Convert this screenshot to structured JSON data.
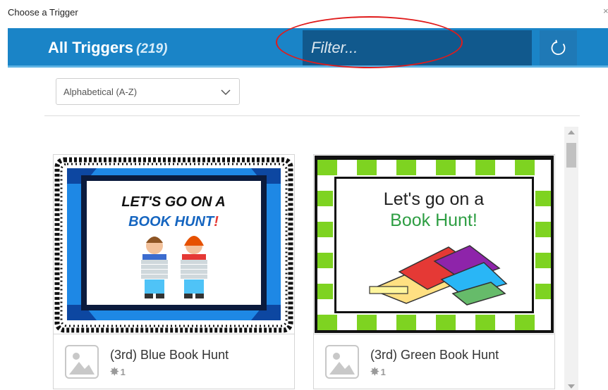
{
  "window": {
    "title": "Choose a Trigger",
    "close": "×"
  },
  "header": {
    "title": "All Triggers",
    "count": "(219)"
  },
  "filter": {
    "placeholder": "Filter..."
  },
  "sort": {
    "selected": "Alphabetical (A-Z)"
  },
  "triggers": [
    {
      "name": "(3rd) Blue Book Hunt",
      "count": "1",
      "image": {
        "line1": "LET'S GO ON A",
        "line2": "BOOK HUNT",
        "line2_suffix": "!"
      }
    },
    {
      "name": "(3rd) Green Book Hunt",
      "count": "1",
      "image": {
        "line1": "Let's go on a",
        "line2": "Book Hunt",
        "line2_suffix": "!"
      }
    }
  ],
  "colors": {
    "header": "#1a84c7",
    "filter_bg": "#11598d",
    "annotation": "#e01b1b",
    "blue_frame": "#1e88e5",
    "green_frame": "#7ed321"
  },
  "icons": [
    "close-icon",
    "refresh-icon",
    "chevron-down-icon",
    "image-placeholder-icon",
    "star-icon"
  ]
}
